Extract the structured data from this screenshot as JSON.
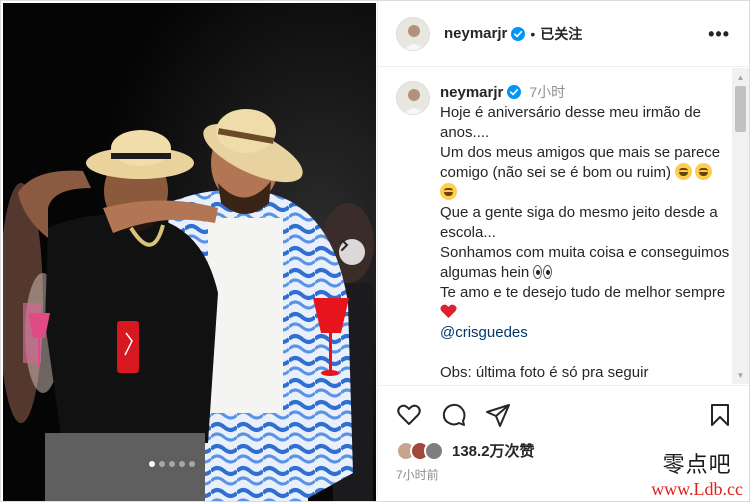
{
  "post": {
    "username": "neymarjr",
    "follow_status": "已关注",
    "separator": "•",
    "more_label": "•••"
  },
  "caption": {
    "username": "neymarjr",
    "time": "7小时",
    "lines": [
      "Hoje é aniversário desse meu irmão de anos....",
      "Um dos meus amigos que mais se parece comigo (não sei se é bom ou ruim)",
      "Que a gente siga do mesmo jeito desde a escola...",
      "Sonhamos com muita coisa e conseguimos algumas hein",
      "Te amo e te desejo tudo de melhor sempre",
      "@crisguedes",
      "Obs: última foto é só pra seguir"
    ]
  },
  "engagement": {
    "likes": "138.2万次赞",
    "time_ago": "7小时前"
  },
  "carousel": {
    "dot_count": 5,
    "active_index": 0
  },
  "watermark": {
    "logo": "零点吧",
    "url": "www.Ldb.cc"
  },
  "icons": {
    "verified": "verified-badge-icon",
    "more": "more-options-icon",
    "like": "heart-icon",
    "comment": "comment-icon",
    "share": "share-icon",
    "save": "bookmark-icon",
    "next": "chevron-right-icon"
  },
  "colors": {
    "verified_blue": "#0095f6",
    "mention": "#00376b",
    "muted": "#8e8e8e",
    "watermark_url": "#e0201b"
  }
}
